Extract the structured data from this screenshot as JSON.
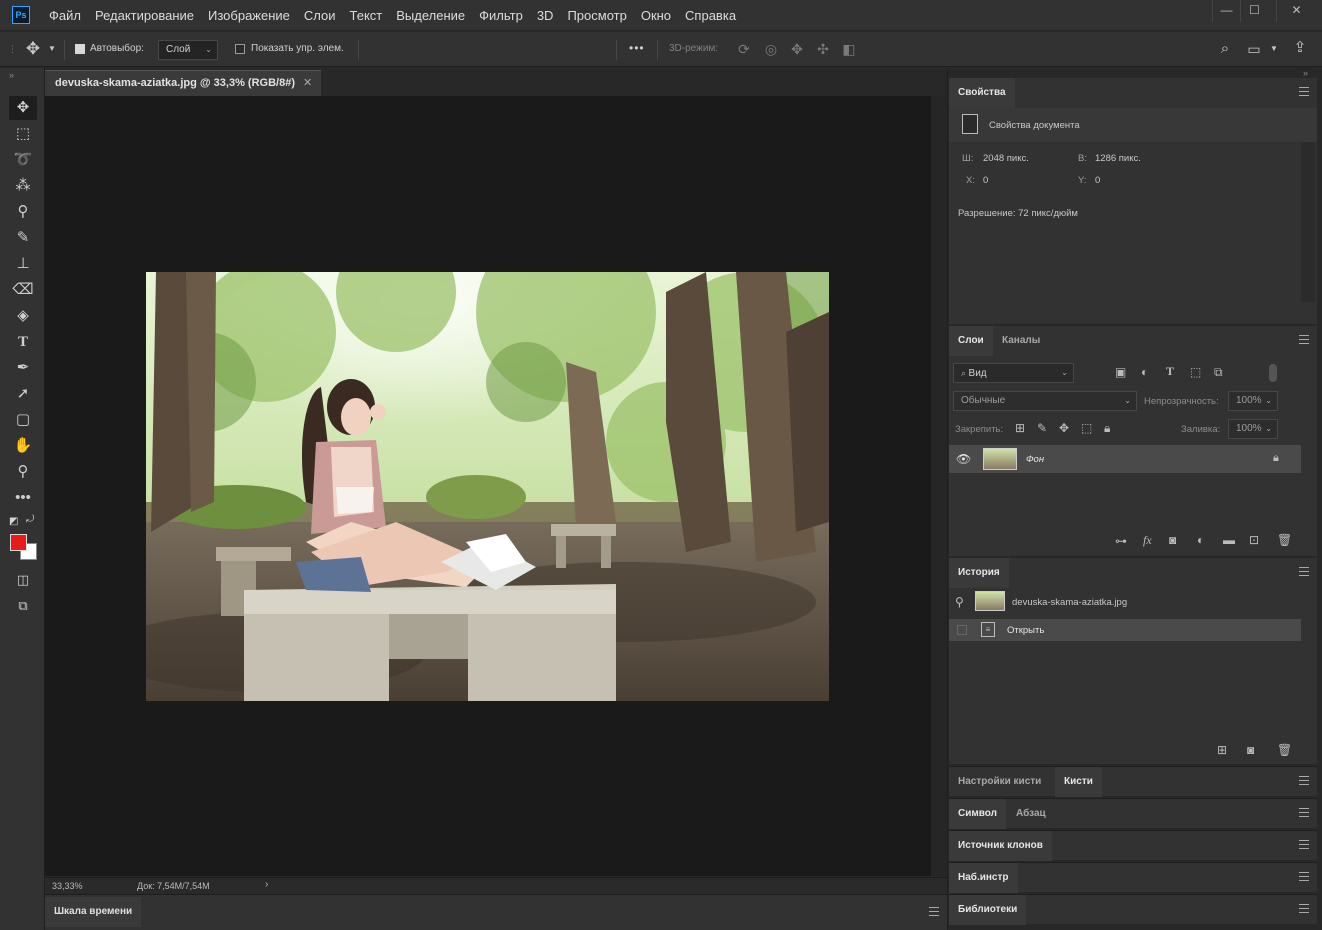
{
  "app": {
    "logo_text": "Ps"
  },
  "menu": [
    "Файл",
    "Редактирование",
    "Изображение",
    "Слои",
    "Текст",
    "Выделение",
    "Фильтр",
    "3D",
    "Просмотр",
    "Окно",
    "Справка"
  ],
  "window_controls": {
    "minimize": "—",
    "maximize": "☐",
    "close": "✕"
  },
  "options_bar": {
    "auto_select_label": "Автовыбор:",
    "auto_select_checked": true,
    "auto_select_target": "Слой",
    "show_transform_label": "Показать упр. элем.",
    "show_transform_checked": false,
    "mode_3d_label": "3D-режим:",
    "more_label": "•••"
  },
  "document": {
    "tab_title": "devuska-skama-aziatka.jpg @ 33,3% (RGB/8#)",
    "zoom": "33,33%",
    "doc_size": "Док: 7,54M/7,54M"
  },
  "colors": {
    "foreground": "#e91a1a",
    "background": "#ffffff",
    "accent": "#31a8ff"
  },
  "timeline": {
    "tab": "Шкала времени"
  },
  "properties": {
    "tab": "Свойства",
    "header": "Свойства документа",
    "w_label": "Ш:",
    "w_value": "2048 пикс.",
    "h_label": "В:",
    "h_value": "1286 пикс.",
    "x_label": "X:",
    "x_value": "0",
    "y_label": "Y:",
    "y_value": "0",
    "resolution": "Разрешение: 72 пикс/дюйм"
  },
  "layers": {
    "tabs": [
      "Слои",
      "Каналы"
    ],
    "filter_kind": "Вид",
    "blend_mode": "Обычные",
    "opacity_label": "Непрозрачность:",
    "opacity_value": "100%",
    "lock_label": "Закрепить:",
    "fill_label": "Заливка:",
    "fill_value": "100%",
    "items": [
      {
        "name": "Фон",
        "visible": true,
        "locked": true
      }
    ]
  },
  "history": {
    "tab": "История",
    "snapshot": "devuska-skama-aziatka.jpg",
    "items": [
      "Открыть"
    ]
  },
  "collapsed_panels": [
    {
      "tabs": [
        "Настройки кисти",
        "Кисти"
      ],
      "active": 1
    },
    {
      "tabs": [
        "Символ",
        "Абзац"
      ],
      "active": 0
    },
    {
      "tabs": [
        "Источник клонов"
      ],
      "active": 0
    },
    {
      "tabs": [
        "Наб.инстр"
      ],
      "active": 0
    },
    {
      "tabs": [
        "Библиотеки"
      ],
      "active": 0
    }
  ]
}
